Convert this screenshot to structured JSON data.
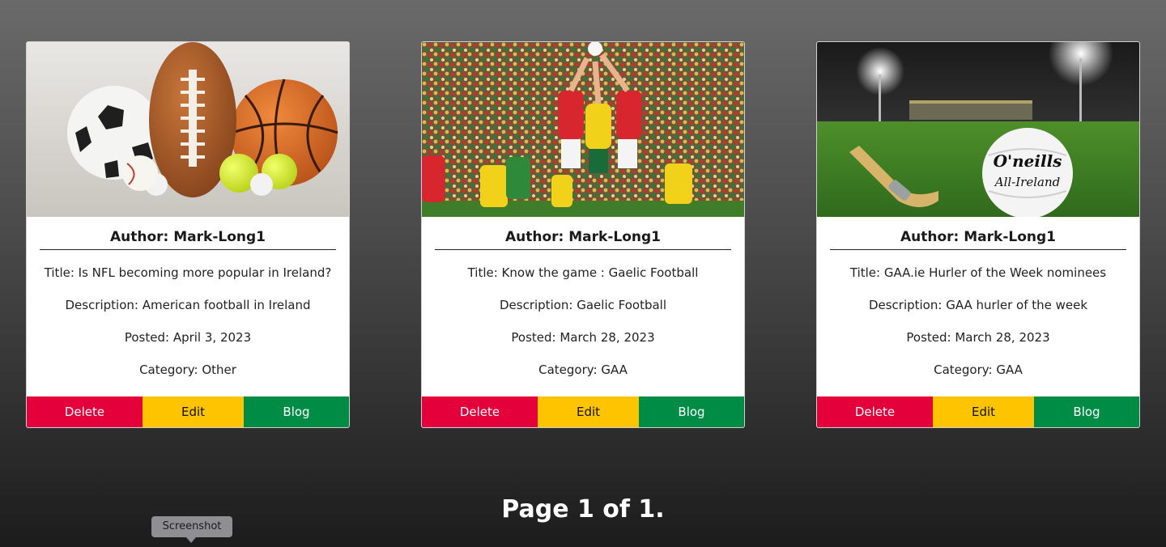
{
  "colors": {
    "delete": "#e4003a",
    "edit": "#ffc400",
    "blog": "#008c45"
  },
  "posts": [
    {
      "image": "sports-balls-image",
      "author": "Author: Mark-Long1",
      "title": "Title: Is NFL becoming more popular in Ireland?",
      "description": "Description: American football in Ireland",
      "posted": "Posted: April 3, 2023",
      "category": "Category: Other",
      "delete_label": "Delete",
      "edit_label": "Edit",
      "blog_label": "Blog"
    },
    {
      "image": "gaelic-football-match-image",
      "author": "Author: Mark-Long1",
      "title": "Title: Know the game : Gaelic Football",
      "description": "Description: Gaelic Football",
      "posted": "Posted: March 28, 2023",
      "category": "Category: GAA",
      "delete_label": "Delete",
      "edit_label": "Edit",
      "blog_label": "Blog"
    },
    {
      "image": "hurling-stadium-image",
      "author": "Author: Mark-Long1",
      "title": "Title: GAA.ie Hurler of the Week nominees",
      "description": "Description: GAA hurler of the week",
      "posted": "Posted: March 28, 2023",
      "category": "Category: GAA",
      "delete_label": "Delete",
      "edit_label": "Edit",
      "blog_label": "Blog"
    }
  ],
  "ball_text": {
    "brand": "O'neills",
    "slogan": "All-Ireland"
  },
  "pagination": {
    "label": "Page 1 of 1."
  },
  "tooltip": {
    "label": "Screenshot"
  }
}
